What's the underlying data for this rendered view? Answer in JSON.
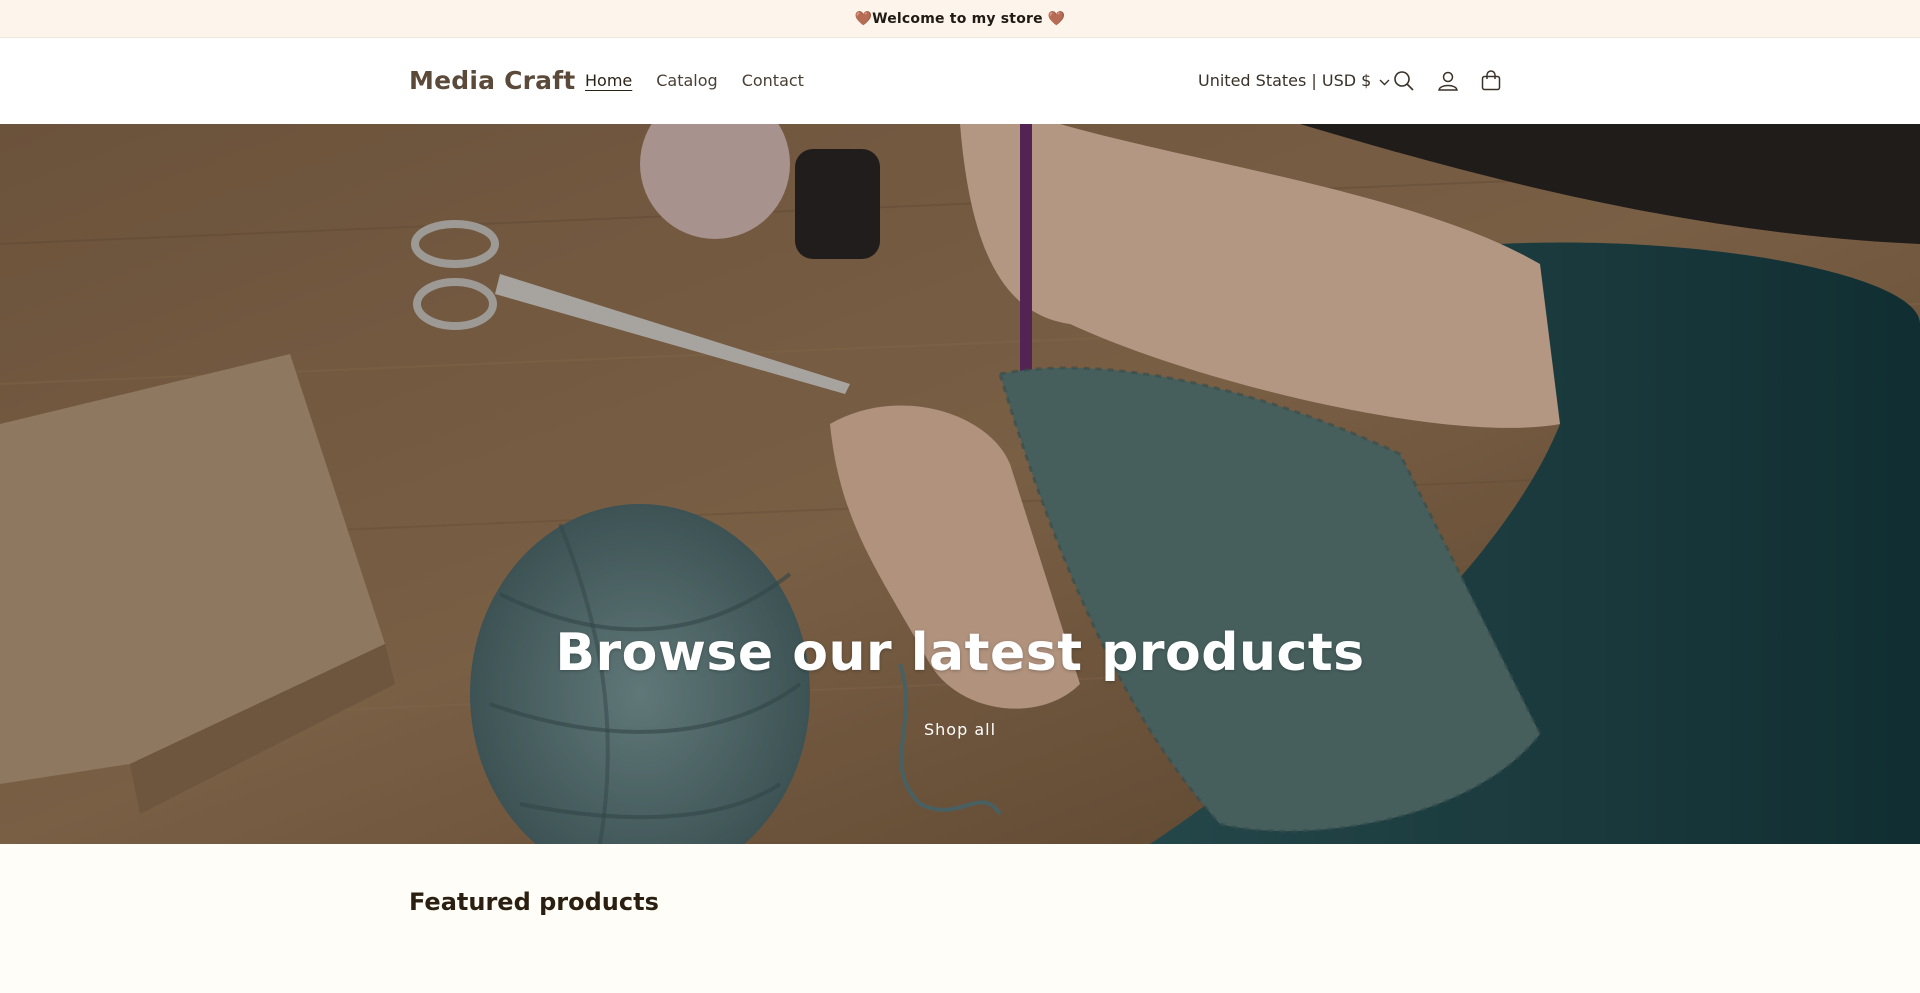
{
  "announcement": {
    "text": "🤎Welcome to my store 🤎"
  },
  "header": {
    "logo": "Media Craft",
    "nav": [
      {
        "label": "Home"
      },
      {
        "label": "Catalog"
      },
      {
        "label": "Contact"
      }
    ],
    "locale": "United States | USD $",
    "icons": [
      "chevron-down-icon",
      "search-icon",
      "account-icon",
      "cart-icon"
    ]
  },
  "hero": {
    "title": "Browse our latest products",
    "link": "Shop all"
  },
  "featured": {
    "title": "Featured products"
  },
  "colors": {
    "announcement_bg": "#fdf4ec",
    "page_bg": "#fffdf7",
    "logo": "#5b4a3a",
    "yarn_teal": "#5d7c7e"
  }
}
